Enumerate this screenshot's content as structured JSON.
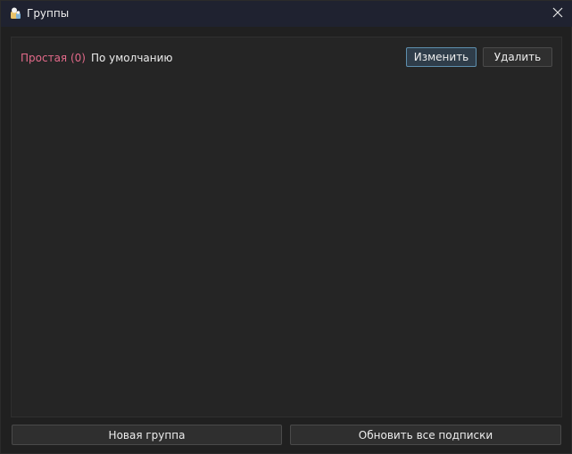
{
  "window": {
    "title": "Группы",
    "close_icon": "close-icon",
    "app_icon": "app-icon"
  },
  "group": {
    "name": "Простая (0)",
    "label": "По умолчанию",
    "name_color": "#e36a8a"
  },
  "actions": {
    "edit_label": "Изменить",
    "delete_label": "Удалить"
  },
  "footer": {
    "new_group_label": "Новая группа",
    "refresh_label": "Обновить все подписки"
  },
  "colors": {
    "accent_border": "#5e8fae",
    "background": "#202020",
    "panel": "#252525"
  }
}
